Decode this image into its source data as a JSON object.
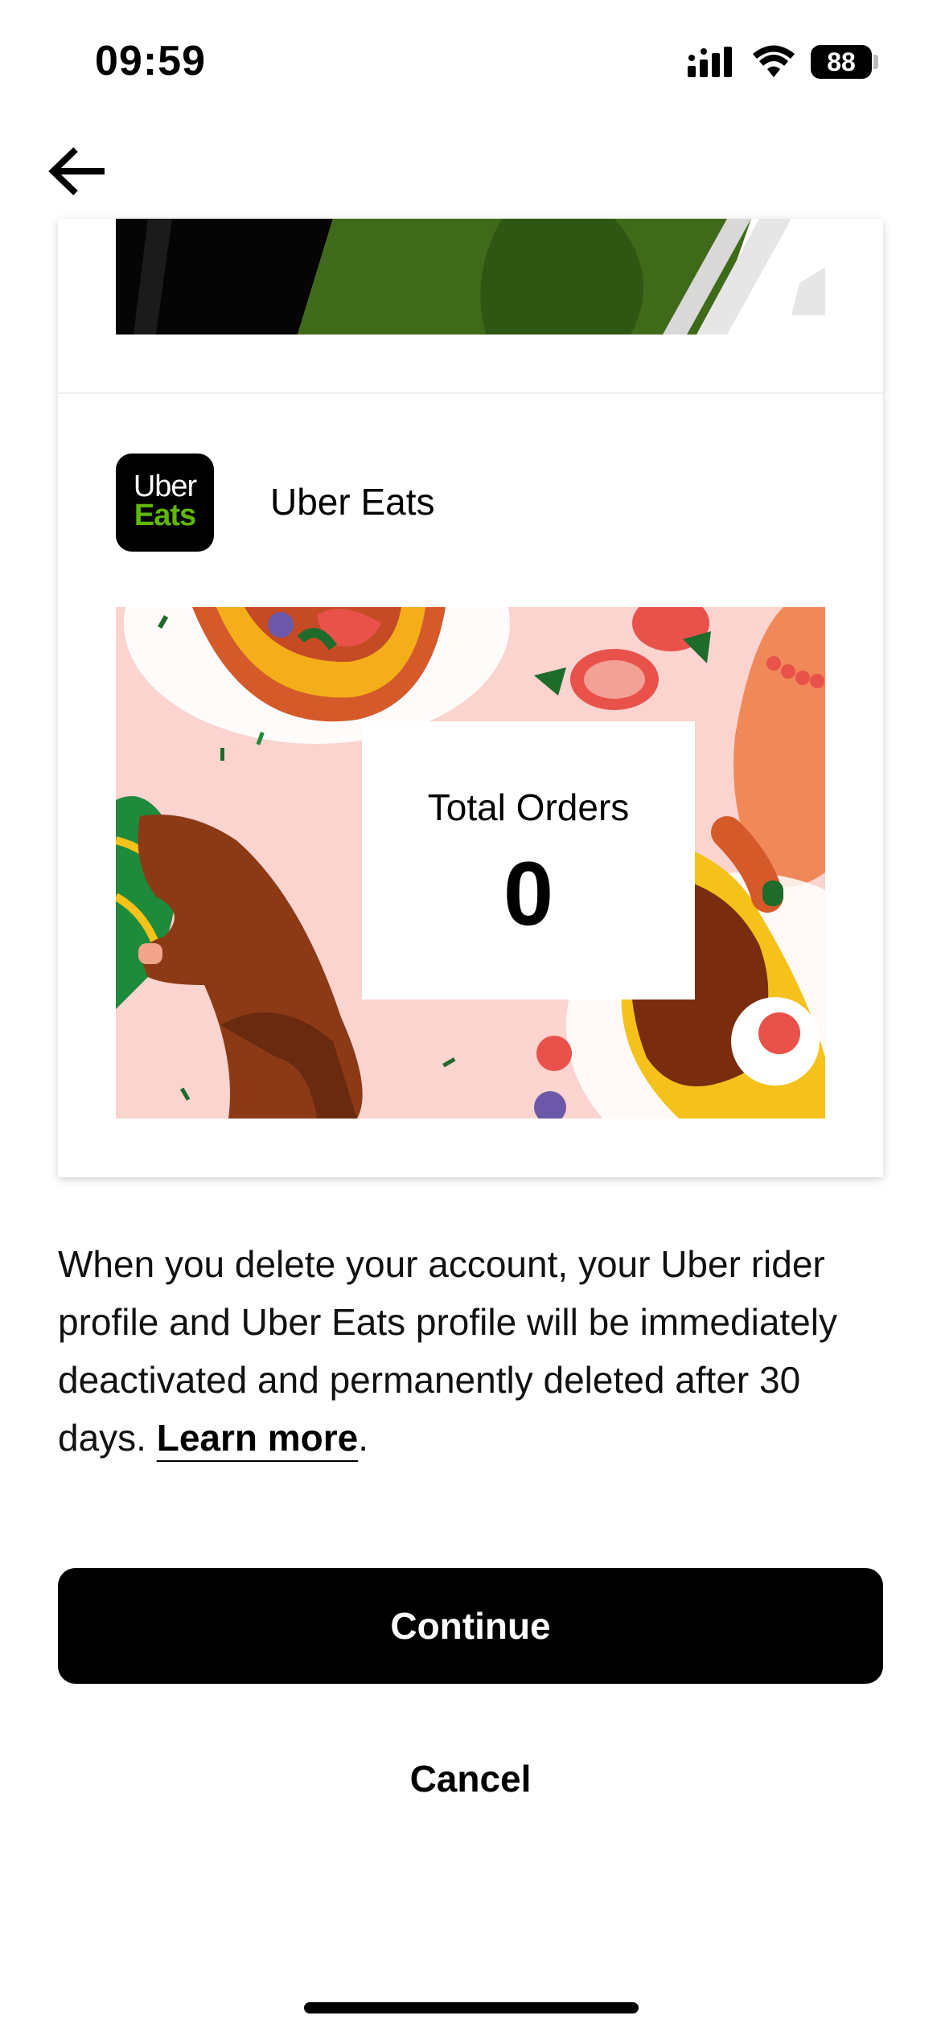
{
  "status_bar": {
    "time": "09:59",
    "battery": "88"
  },
  "card": {
    "app": {
      "icon_line1": "Uber",
      "icon_line2": "Eats",
      "name": "Uber Eats"
    },
    "stat": {
      "label": "Total Orders",
      "value": "0"
    }
  },
  "info": {
    "text": "When you delete your account, your Uber rider profile and Uber Eats profile will be immediately deactivated and permanently deleted after 30 days. ",
    "link": "Learn more",
    "end": "."
  },
  "actions": {
    "continue_label": "Continue",
    "cancel_label": "Cancel"
  },
  "icons": {
    "back": "arrow-left-icon",
    "signal": "cellular-signal-icon",
    "wifi": "wifi-icon",
    "battery": "battery-icon"
  },
  "colors": {
    "primary": "#000000",
    "eats_green": "#5fb709",
    "art_background": "#fbd3cf"
  }
}
